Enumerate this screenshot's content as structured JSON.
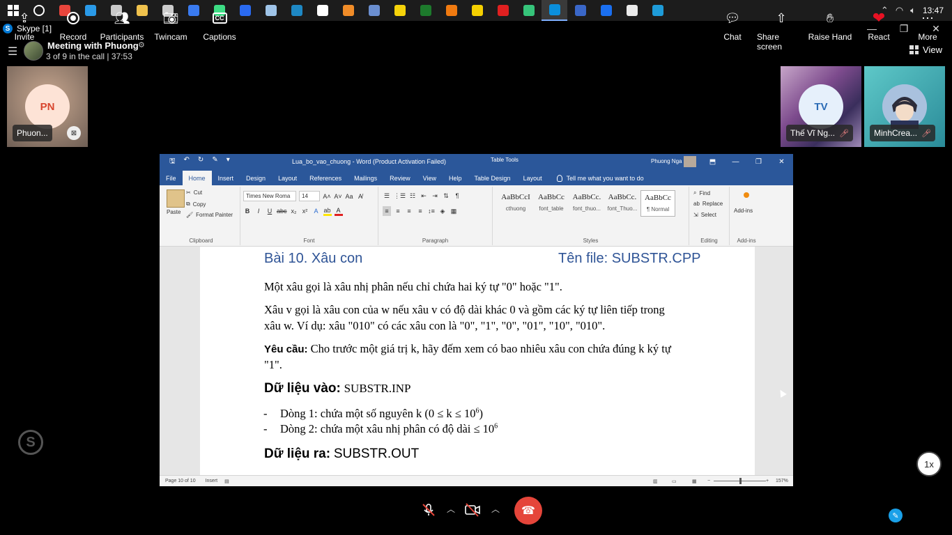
{
  "taskbar": {
    "time": "13:47",
    "apps": [
      {
        "name": "search-icon",
        "color": "#ffffff"
      },
      {
        "name": "chrome-icon",
        "color": "#e8453c"
      },
      {
        "name": "vscode-icon",
        "color": "#2a9ae8"
      },
      {
        "name": "app-icon",
        "color": "#c9c9c9"
      },
      {
        "name": "folder-icon",
        "color": "#f0c24d"
      },
      {
        "name": "check-icon",
        "color": "#cccccc"
      },
      {
        "name": "app-icon",
        "color": "#3a7bf0"
      },
      {
        "name": "android-icon",
        "color": "#3ddc84"
      },
      {
        "name": "app-icon",
        "color": "#2a6af0"
      },
      {
        "name": "steam-icon",
        "color": "#9fc4e8"
      },
      {
        "name": "app-icon",
        "color": "#1e88c4"
      },
      {
        "name": "app-icon",
        "color": "#ffffff"
      },
      {
        "name": "blender-icon",
        "color": "#f08c28"
      },
      {
        "name": "app-icon",
        "color": "#6b8fd0"
      },
      {
        "name": "app-icon",
        "color": "#f6d30a"
      },
      {
        "name": "pt-icon",
        "color": "#1d7a2c"
      },
      {
        "name": "search-tool-icon",
        "color": "#f07a10"
      },
      {
        "name": "duck-icon",
        "color": "#f5d000"
      },
      {
        "name": "record-icon",
        "color": "#e02020"
      },
      {
        "name": "app-icon",
        "color": "#36c47a"
      },
      {
        "name": "skype-icon",
        "color": "#0a8fdc"
      },
      {
        "name": "word-icon",
        "color": "#3a67c8"
      },
      {
        "name": "zalo-icon",
        "color": "#1a6ff0"
      },
      {
        "name": "document-icon",
        "color": "#eaeaea"
      },
      {
        "name": "app-icon",
        "color": "#1e9bd8"
      }
    ]
  },
  "skype": {
    "title": "Skype [1]",
    "meeting_title": "Meeting with Phuong",
    "meeting_sub": "3 of 9 in the call | 37:53",
    "view_label": "View",
    "participants": [
      {
        "initials": "PN",
        "name": "Phuon..."
      },
      {
        "initials": "TV",
        "name": "Thế Vĩ Ng..."
      },
      {
        "initials": "",
        "name": "MinhCrea..."
      }
    ],
    "speed": "1x"
  },
  "word": {
    "doc_title": "Lua_bo_vao_chuong - Word (Product Activation Failed)",
    "table_tools": "Table Tools",
    "user": "Phuong Nga",
    "tabs": [
      "File",
      "Home",
      "Insert",
      "Design",
      "Layout",
      "References",
      "Mailings",
      "Review",
      "View",
      "Help",
      "Table Design",
      "Layout"
    ],
    "tell_me": "Tell me what you want to do",
    "clipboard": {
      "paste": "Paste",
      "cut": "Cut",
      "copy": "Copy",
      "format_painter": "Format Painter",
      "label": "Clipboard"
    },
    "font": {
      "name": "Times New Roma",
      "size": "14",
      "label": "Font"
    },
    "paragraph_label": "Paragraph",
    "styles": [
      {
        "sample": "AaBbCcI",
        "name": "cthuong"
      },
      {
        "sample": "AaBbCc",
        "name": "font_table"
      },
      {
        "sample": "AaBbCc.",
        "name": "font_thuo..."
      },
      {
        "sample": "AaBbCc.",
        "name": "font_Thuo..."
      },
      {
        "sample": "AaBbCc",
        "name": "¶ Normal"
      }
    ],
    "styles_label": "Styles",
    "editing": {
      "find": "Find",
      "replace": "Replace",
      "select": "Select",
      "label": "Editing"
    },
    "addins": {
      "label": "Add-ins",
      "group": "Add-ins"
    },
    "status": {
      "page": "Page 10 of 10",
      "mode": "Insert",
      "zoom": "157%"
    }
  },
  "document": {
    "heading": "Bài 10. Xâu con",
    "filename": "Tên file: SUBSTR.CPP",
    "p1": "Một xâu gọi là xâu nhị phân nếu chỉ chứa hai ký tự \"0\" hoặc \"1\".",
    "p2_line1": "Xâu v gọi là xâu con của w nếu xâu v có độ dài khác 0 và gồm các ký tự liên tiếp trong",
    "p2_line2": "xâu w. Ví dụ: xâu \"010\" có các xâu con là \"0\", \"1\", \"0\", \"01\", \"10\", \"010\".",
    "req_label": "Yêu cầu:",
    "req_text": "Cho trước một giá trị k, hãy đếm xem có bao nhiêu xâu con chứa đúng k ký tự",
    "req_text2": "\"1\".",
    "input_label": "Dữ liệu vào:",
    "input_file": "SUBSTR.INP",
    "line1": "Dòng 1: chứa một số nguyên k (0 ≤ k ≤ 10",
    "line1_exp": "6",
    "line1_end": ")",
    "line2": "Dòng 2: chứa một xâu nhị phân có độ dài ≤ 10",
    "line2_exp": "6",
    "output_label": "Dữ liệu ra:",
    "output_file": "SUBSTR.OUT"
  },
  "callbar": {
    "invite": "Invite",
    "record": "Record",
    "participants": "Participants",
    "twincam": "Twincam",
    "captions": "Captions",
    "chat": "Chat",
    "share_screen": "Share screen",
    "raise_hand": "Raise Hand",
    "react": "React",
    "more": "More"
  }
}
